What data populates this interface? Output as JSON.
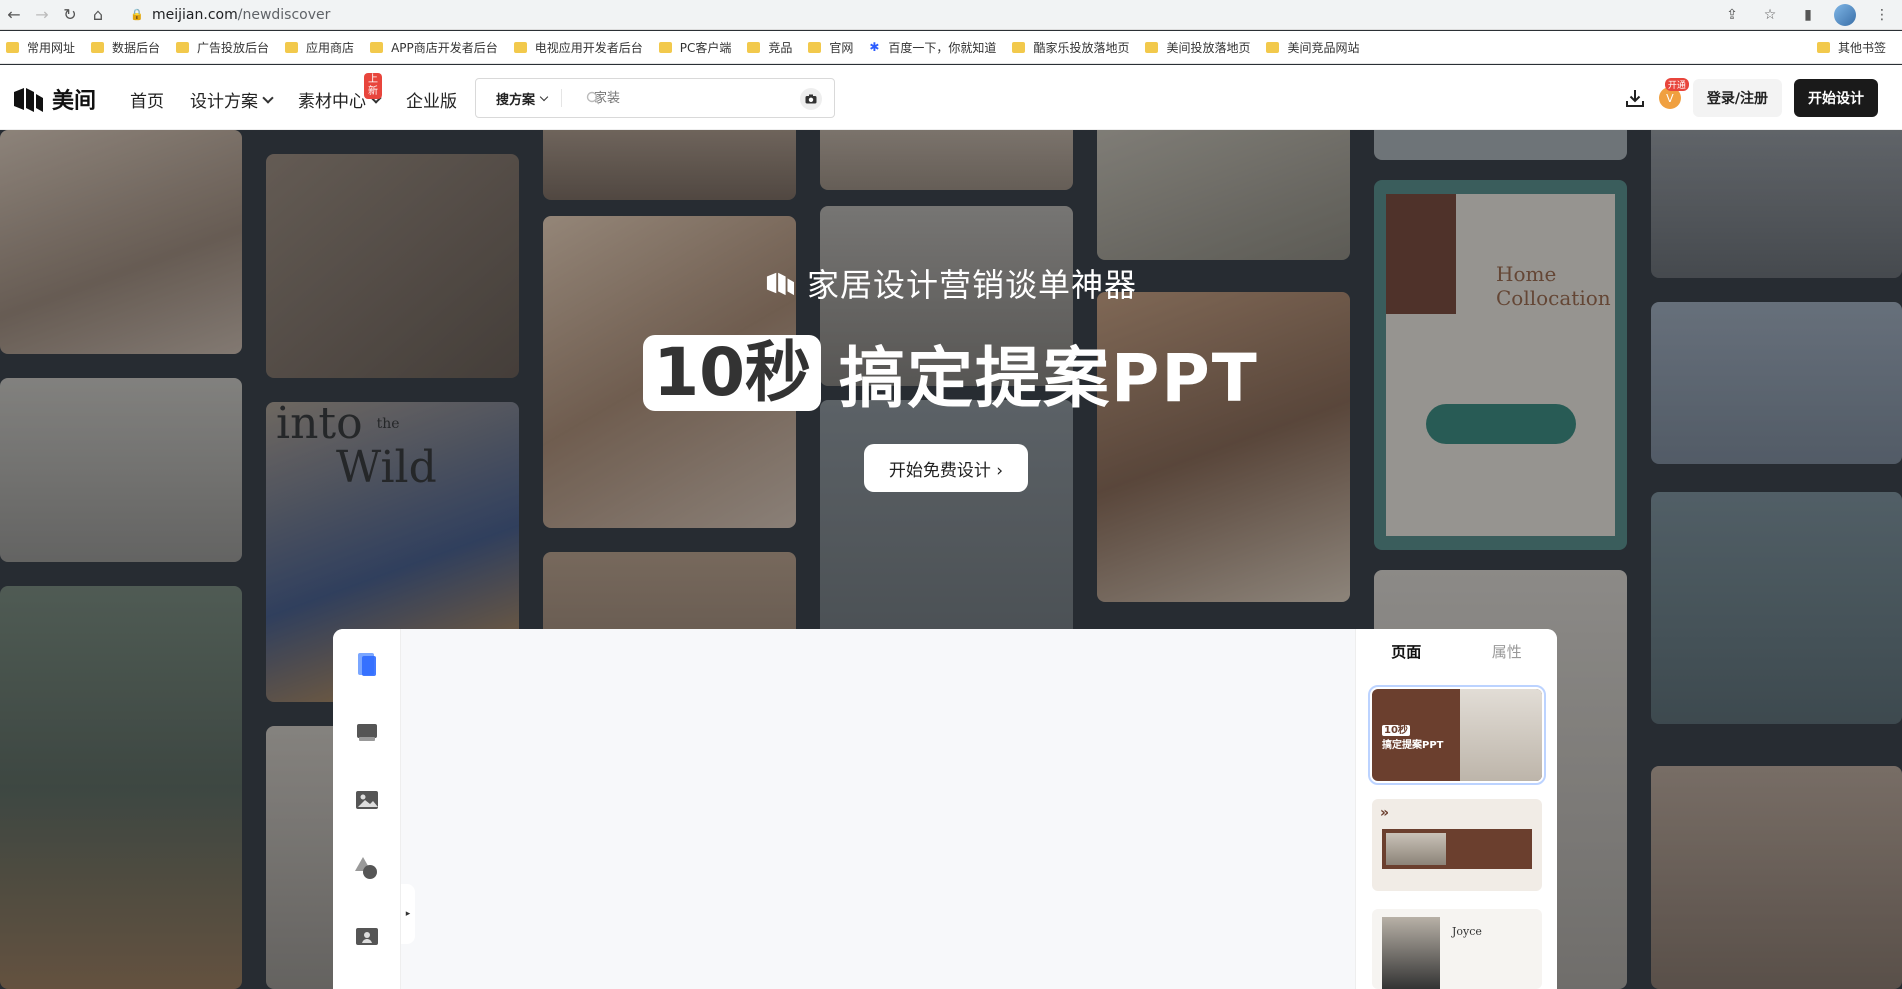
{
  "browser": {
    "url_host": "meijian.com",
    "url_path": "/newdiscover"
  },
  "bookmarks": {
    "items": [
      "常用网址",
      "数据后台",
      "广告投放后台",
      "应用商店",
      "APP商店开发者后台",
      "电视应用开发者后台",
      "PC客户端",
      "竞品",
      "官网",
      "百度一下，你就知道",
      "酷家乐投放落地页",
      "美间投放落地页",
      "美间竞品网站"
    ],
    "other": "其他书签"
  },
  "nav": {
    "logo_text": "美间",
    "menu": [
      "首页",
      "设计方案",
      "素材中心",
      "企业版"
    ],
    "new_badge": "上新",
    "search_type": "搜方案",
    "search_placeholder": "家装",
    "vip_tag": "开通",
    "vip_letter": "V",
    "login_label": "登录/注册",
    "start_label": "开始设计"
  },
  "hero": {
    "subtitle": "家居设计营销谈单神器",
    "title_pill": "10秒",
    "title_rest": "搞定提案PPT",
    "cta": "开始免费设计 ›"
  },
  "editor": {
    "tab_page": "页面",
    "tab_attr": "属性",
    "thumb1_title": "10秒",
    "thumb1_sub": "搞定提案PPT",
    "thumb3_name": "Joyce"
  },
  "tiles": {
    "wild_text_1": "into",
    "wild_text_2": "the",
    "wild_text_3": "Wild",
    "home_1": "Home",
    "home_2": "Collocation"
  }
}
